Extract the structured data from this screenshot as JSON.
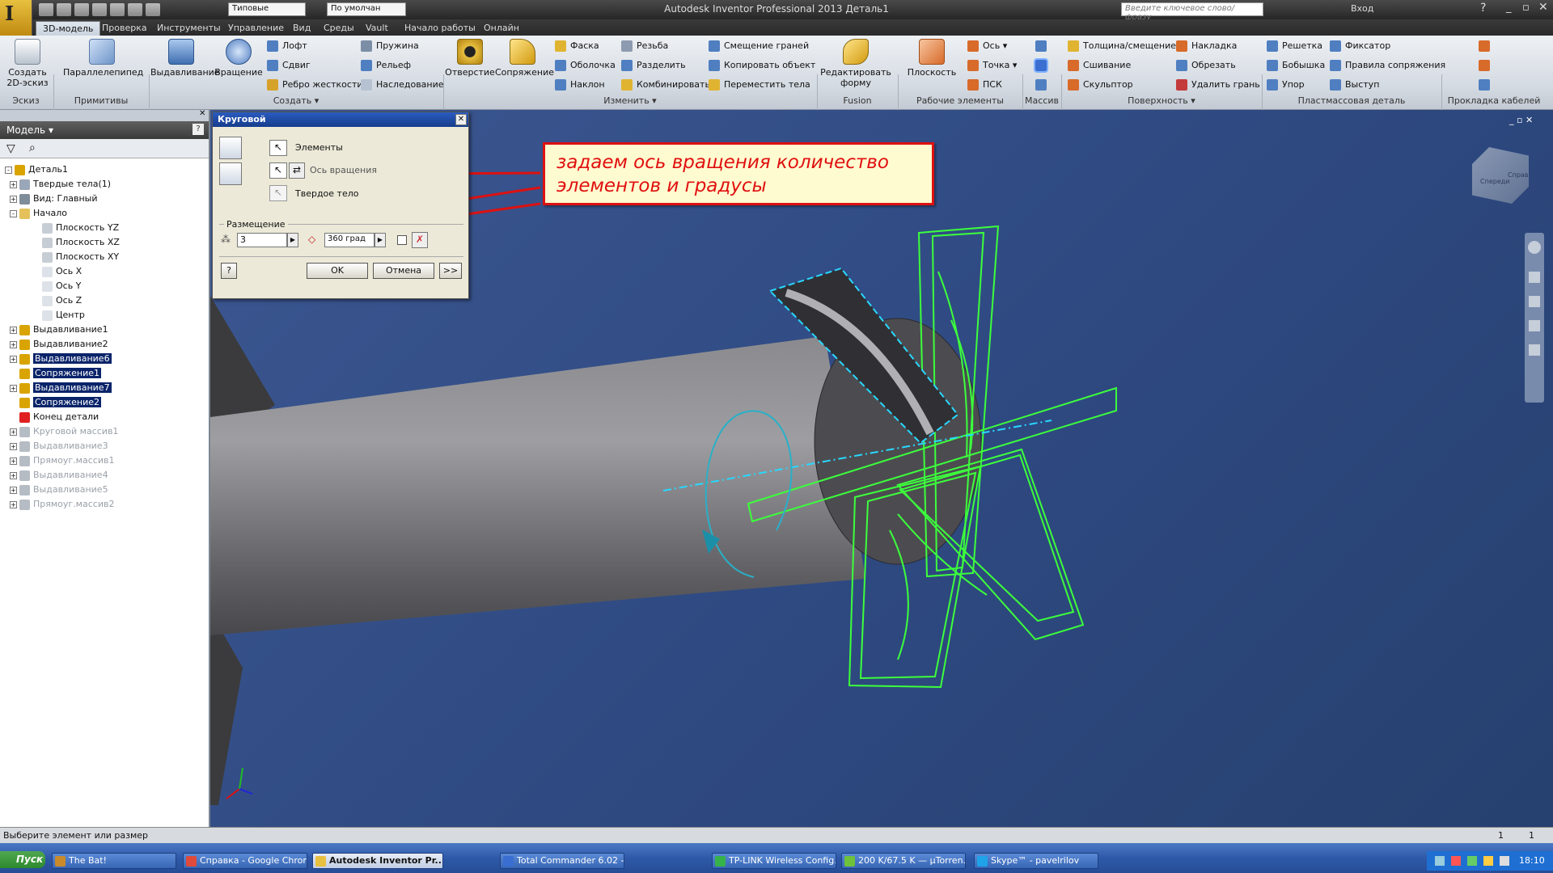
{
  "window": {
    "title": "Autodesk Inventor Professional 2013   Деталь1",
    "qat_combo1": "Типовые",
    "qat_combo2": "По умолчан",
    "search_placeholder": "Введите ключевое слово/фразу",
    "signin": "Вход"
  },
  "tabs": [
    "3D-модель",
    "Проверка",
    "Инструменты",
    "Управление",
    "Вид",
    "Среды",
    "Vault",
    "Начало работы",
    "Онлайн"
  ],
  "ribbon": {
    "sketch": {
      "btn": "Создать 2D-эскиз",
      "group": "Эскиз"
    },
    "primitives": {
      "btn": "Параллелепипед",
      "group": "Примитивы"
    },
    "create": {
      "extrude": "Выдавливание",
      "revolve": "Вращение",
      "loft": "Лофт",
      "sweep": "Сдвиг",
      "rib": "Ребро жесткости",
      "coil": "Пружина",
      "emboss": "Рельеф",
      "derive": "Наследование",
      "group": "Создать"
    },
    "modify": {
      "hole": "Отверстие",
      "fillet": "Сопряжение",
      "chamfer": "Фаска",
      "shell": "Оболочка",
      "draft": "Наклон",
      "thread": "Резьба",
      "split": "Разделить",
      "combine": "Комбинировать",
      "offset_faces": "Смещение граней",
      "copy_object": "Копировать объект",
      "move_bodies": "Переместить тела",
      "group": "Изменить"
    },
    "fusion": {
      "btn": "Редактировать форму",
      "group": "Fusion"
    },
    "work": {
      "plane": "Плоскость",
      "axis": "Ось",
      "point": "Точка",
      "ucs": "ПСК",
      "group": "Рабочие элементы"
    },
    "pattern": {
      "group": "Массив"
    },
    "surface": {
      "thicken": "Толщина/смещение",
      "stitch": "Сшивание",
      "sculpt": "Скульптор",
      "patch": "Накладка",
      "trim": "Обрезать",
      "delete_face": "Удалить грань",
      "group": "Поверхность"
    },
    "plastic": {
      "grill": "Решетка",
      "boss": "Бобышка",
      "rest": "Упор",
      "snap_fit": "Фиксатор",
      "rule_fillet": "Правила сопряжения",
      "lip": "Выступ",
      "group": "Пластмассовая деталь"
    },
    "harness": {
      "group": "Прокладка кабелей"
    }
  },
  "panel": {
    "title": "Модель",
    "tree": [
      {
        "label": "Деталь1",
        "level": 0,
        "exp": "-",
        "color": "#d9a400",
        "state": "normal"
      },
      {
        "label": "Твердые тела(1)",
        "level": 1,
        "exp": "+",
        "color": "#9aa7b8",
        "state": "normal"
      },
      {
        "label": "Вид: Главный",
        "level": 1,
        "exp": "+",
        "color": "#7f8c99",
        "state": "normal"
      },
      {
        "label": "Начало",
        "level": 1,
        "exp": "-",
        "color": "#e4c15a",
        "state": "normal"
      },
      {
        "label": "Плоскость YZ",
        "level": 2,
        "exp": "",
        "color": "#c7cdd4",
        "state": "normal"
      },
      {
        "label": "Плоскость XZ",
        "level": 2,
        "exp": "",
        "color": "#c7cdd4",
        "state": "normal"
      },
      {
        "label": "Плоскость XY",
        "level": 2,
        "exp": "",
        "color": "#c7cdd4",
        "state": "normal"
      },
      {
        "label": "Ось X",
        "level": 2,
        "exp": "",
        "color": "#dde2e8",
        "state": "normal"
      },
      {
        "label": "Ось Y",
        "level": 2,
        "exp": "",
        "color": "#dde2e8",
        "state": "normal"
      },
      {
        "label": "Ось Z",
        "level": 2,
        "exp": "",
        "color": "#dde2e8",
        "state": "normal"
      },
      {
        "label": "Центр",
        "level": 2,
        "exp": "",
        "color": "#dde2e8",
        "state": "normal"
      },
      {
        "label": "Выдавливание1",
        "level": 1,
        "exp": "+",
        "color": "#d9a400",
        "state": "normal"
      },
      {
        "label": "Выдавливание2",
        "level": 1,
        "exp": "+",
        "color": "#d9a400",
        "state": "normal"
      },
      {
        "label": "Выдавливание6",
        "level": 1,
        "exp": "+",
        "color": "#d9a400",
        "state": "sel"
      },
      {
        "label": "Сопряжение1",
        "level": 1,
        "exp": "",
        "color": "#d9a400",
        "state": "sel"
      },
      {
        "label": "Выдавливание7",
        "level": 1,
        "exp": "+",
        "color": "#d9a400",
        "state": "sel"
      },
      {
        "label": "Сопряжение2",
        "level": 1,
        "exp": "",
        "color": "#d9a400",
        "state": "sel"
      },
      {
        "label": "Конец детали",
        "level": 1,
        "exp": "",
        "color": "#e02020",
        "state": "normal"
      },
      {
        "label": "Круговой массив1",
        "level": 1,
        "exp": "+",
        "color": "#b6bcc4",
        "state": "dim"
      },
      {
        "label": "Выдавливание3",
        "level": 1,
        "exp": "+",
        "color": "#b6bcc4",
        "state": "dim"
      },
      {
        "label": "Прямоуг.массив1",
        "level": 1,
        "exp": "+",
        "color": "#b6bcc4",
        "state": "dim"
      },
      {
        "label": "Выдавливание4",
        "level": 1,
        "exp": "+",
        "color": "#b6bcc4",
        "state": "dim"
      },
      {
        "label": "Выдавливание5",
        "level": 1,
        "exp": "+",
        "color": "#b6bcc4",
        "state": "dim"
      },
      {
        "label": "Прямоуг.массив2",
        "level": 1,
        "exp": "+",
        "color": "#b6bcc4",
        "state": "dim"
      }
    ]
  },
  "dialog": {
    "title": "Круговой",
    "features": "Элементы",
    "rotation_axis": "Ось вращения",
    "solid": "Твердое тело",
    "placement": "Размещение",
    "count": "3",
    "angle": "360 град",
    "ok": "OK",
    "cancel": "Отмена",
    "more": ">>"
  },
  "callout": {
    "text": "задаем ось вращения количество элементов и градусы"
  },
  "viewcube": {
    "front": "Спереди",
    "right": "Справа"
  },
  "statusbar": {
    "text": "Выберите элемент или размер",
    "num1": "1",
    "num2": "1"
  },
  "taskbar": {
    "start": "Пуск",
    "items": [
      {
        "label": "The Bat!",
        "color": "#c98a2b",
        "active": false
      },
      {
        "label": "Справка - Google Chrome",
        "color": "#e04a3a",
        "active": false
      },
      {
        "label": "Autodesk Inventor Pr...",
        "color": "#e8c040",
        "active": true
      },
      {
        "label": "Total Commander 6.02 - ...",
        "color": "#3a6fd1",
        "active": false
      },
      {
        "label": "TP-LINK Wireless Config...",
        "color": "#36b24a",
        "active": false
      },
      {
        "label": "200 K/67.5 K — µTorren...",
        "color": "#6ec23b",
        "active": false
      },
      {
        "label": "Skype™ - pavelrilov",
        "color": "#1fa2e8",
        "active": false
      }
    ],
    "clock": "18:10"
  }
}
